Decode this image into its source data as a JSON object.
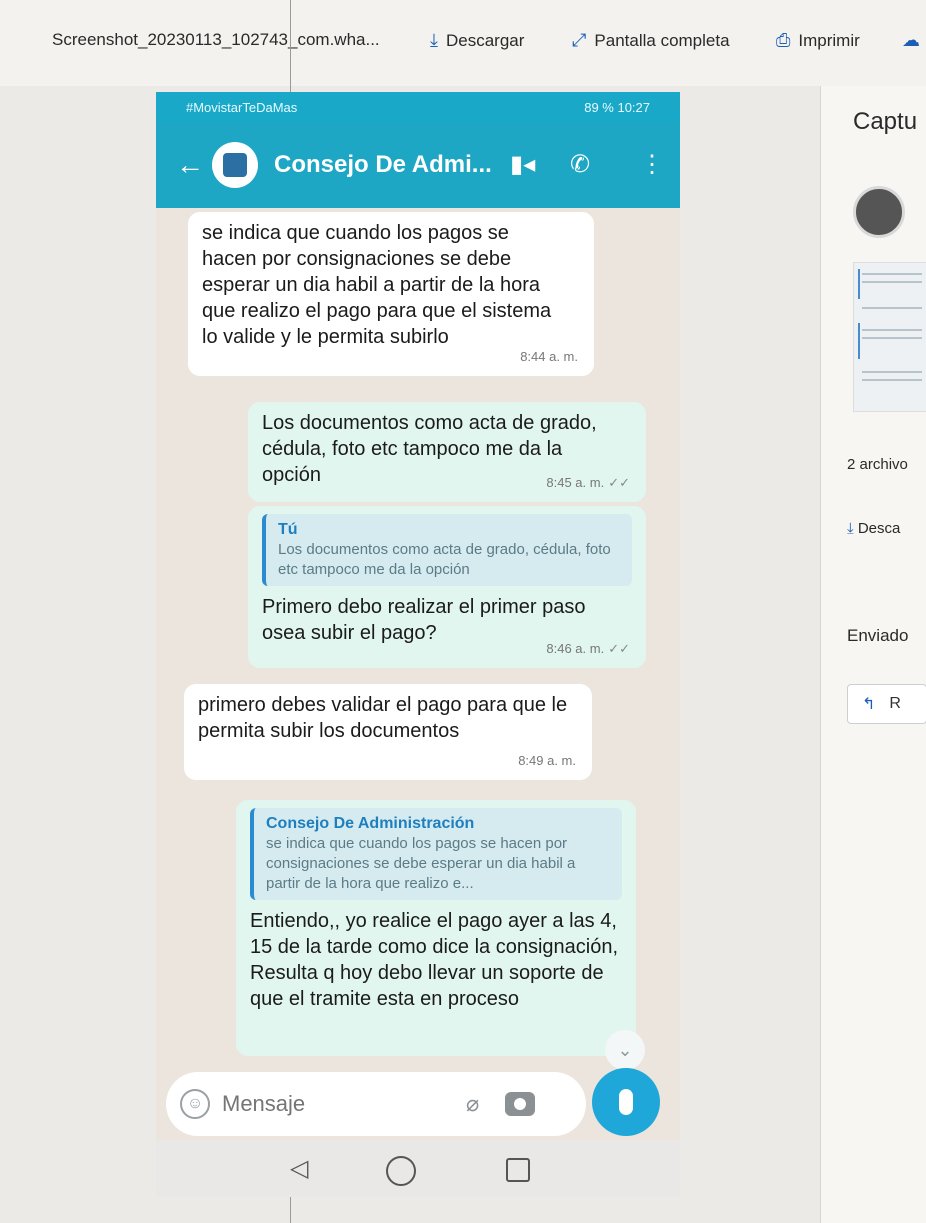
{
  "viewer": {
    "filename": "Screenshot_20230113_102743_com.wha...",
    "download": "Descargar",
    "fullscreen": "Pantalla completa",
    "print": "Imprimir"
  },
  "phone": {
    "statusbar": "#MovistarTeDaMas",
    "statusbar_right": "89 % 10:27",
    "chat_title": "Consejo De Admi...",
    "messages": [
      {
        "dir": "in",
        "text": "se indica que cuando los pagos se hacen por consignaciones se debe esperar un dia habil a partir de la hora que realizo el pago para que el sistema lo valide y le permita subirlo",
        "time": "8:44 a. m."
      },
      {
        "dir": "out",
        "text": "Los documentos como acta de grado, cédula, foto etc tampoco me da la opción",
        "time": "8:45 a. m."
      },
      {
        "dir": "out",
        "quote_author": "Tú",
        "quote_text": "Los documentos como acta de grado, cédula, foto etc tampoco me da la opción",
        "text": "Primero debo realizar el primer paso osea subir el pago?",
        "time": "8:46 a. m."
      },
      {
        "dir": "in",
        "text": "primero debes validar el pago para que le permita subir los documentos",
        "time": "8:49 a. m."
      },
      {
        "dir": "out",
        "quote_author": "Consejo De Administración",
        "quote_text": "se indica que cuando los pagos se hacen por consignaciones se debe esperar un dia habil a partir de la hora que realizo e...",
        "text": "Entiendo,, yo realice el pago ayer a las 4, 15 de la tarde como dice la consignación, Resulta q hoy debo llevar un soporte de que el tramite esta en proceso"
      }
    ],
    "input_placeholder": "Mensaje"
  },
  "side": {
    "title": "Captu",
    "attachments": "2 archivo",
    "download": "Desca",
    "sent": "Enviado",
    "reply": "R"
  },
  "colors": {
    "header": "#1ea7c5",
    "chat_bg": "#ece5dd",
    "outgoing_bubble": "#e2f6f0",
    "accent_blue": "#1a5fb4"
  }
}
